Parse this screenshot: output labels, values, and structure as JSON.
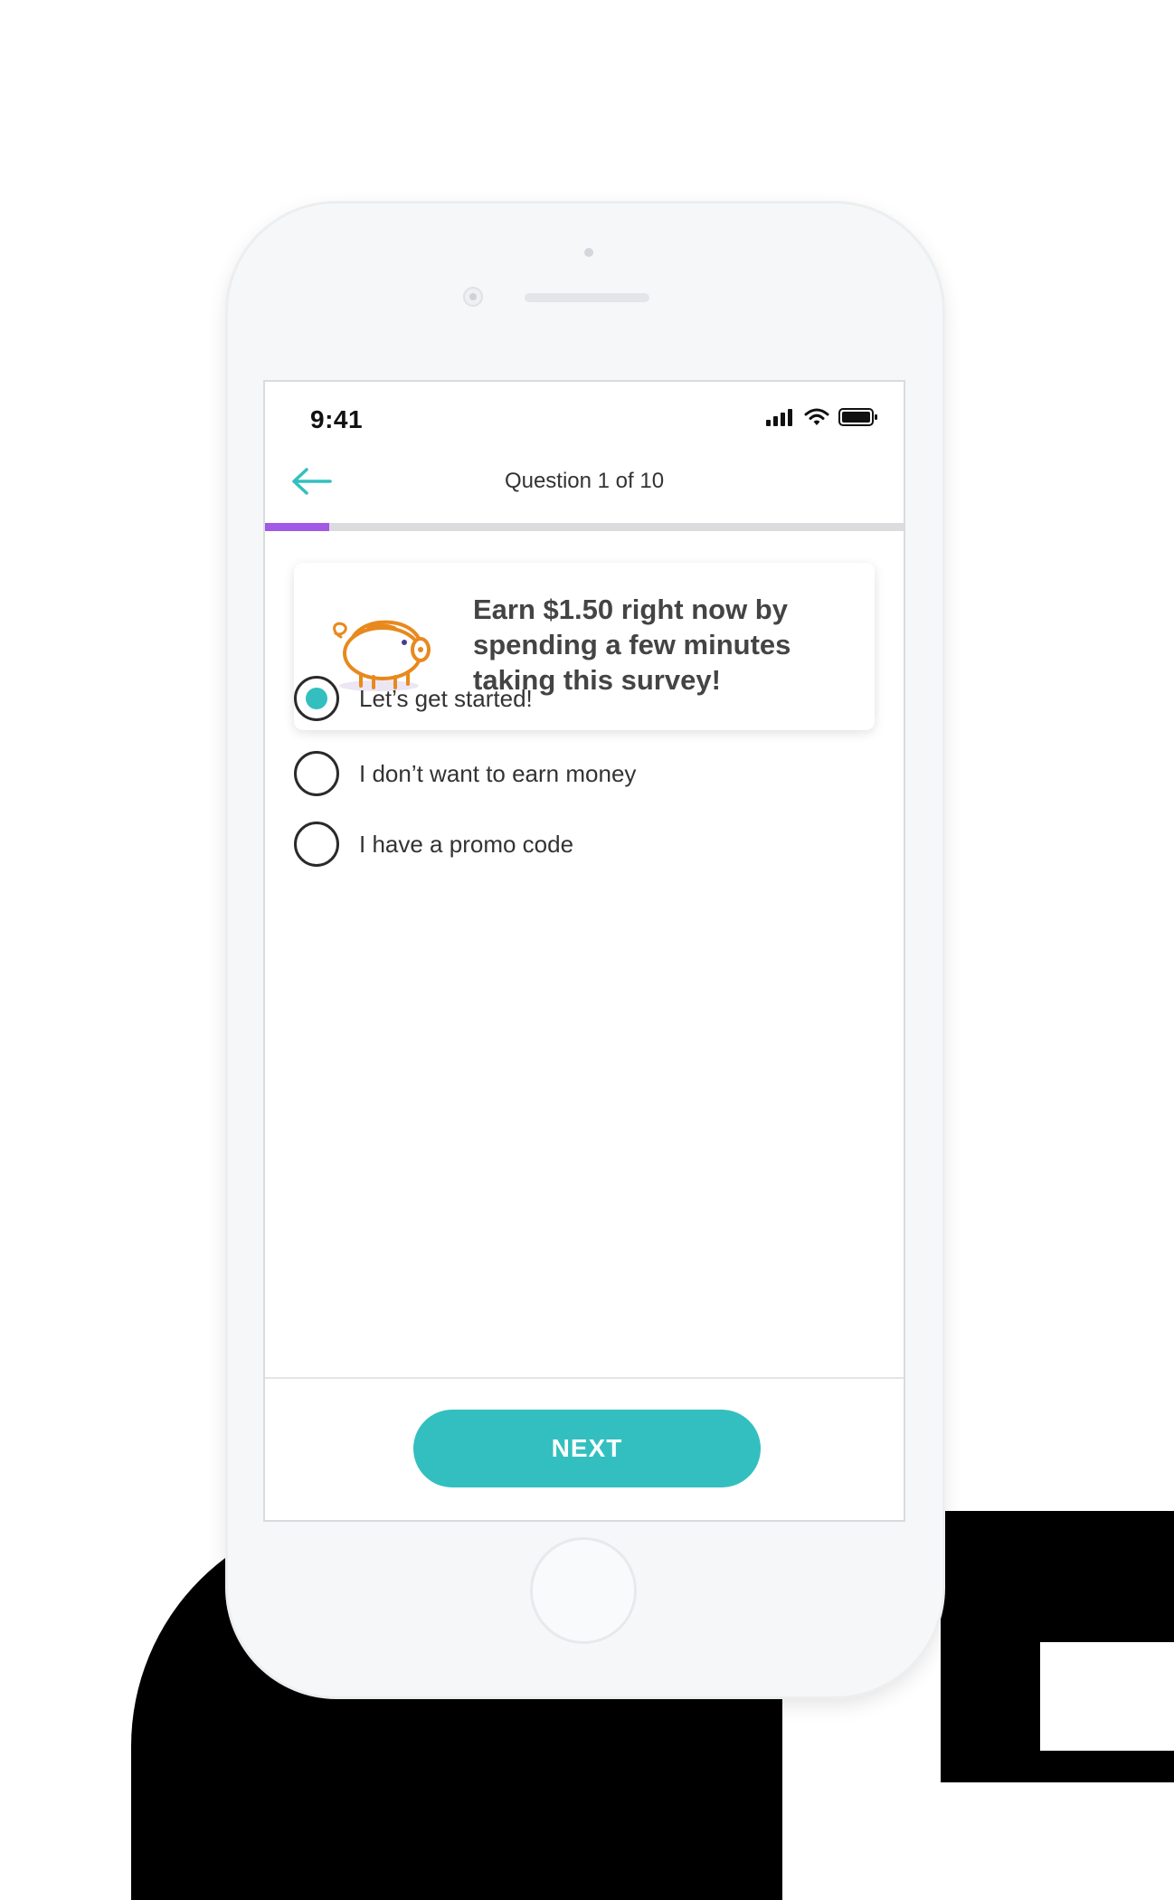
{
  "status_bar": {
    "time": "9:41"
  },
  "header": {
    "title": "Question 1 of 10"
  },
  "progress": {
    "current": 1,
    "total": 10,
    "fraction": 0.1,
    "fill_color": "#a259e6"
  },
  "card": {
    "text": "Earn $1.50 right now by spending a few minutes taking this survey!",
    "icon": "piggy-bank-icon"
  },
  "options": [
    {
      "label": "Let’s get started!",
      "selected": true
    },
    {
      "label": "I don’t want to earn money",
      "selected": false
    },
    {
      "label": "I have a promo code",
      "selected": false
    }
  ],
  "footer": {
    "next_label": "NEXT"
  },
  "colors": {
    "accent": "#33bfbf",
    "progress": "#a259e6",
    "pig": "#e8891e"
  }
}
